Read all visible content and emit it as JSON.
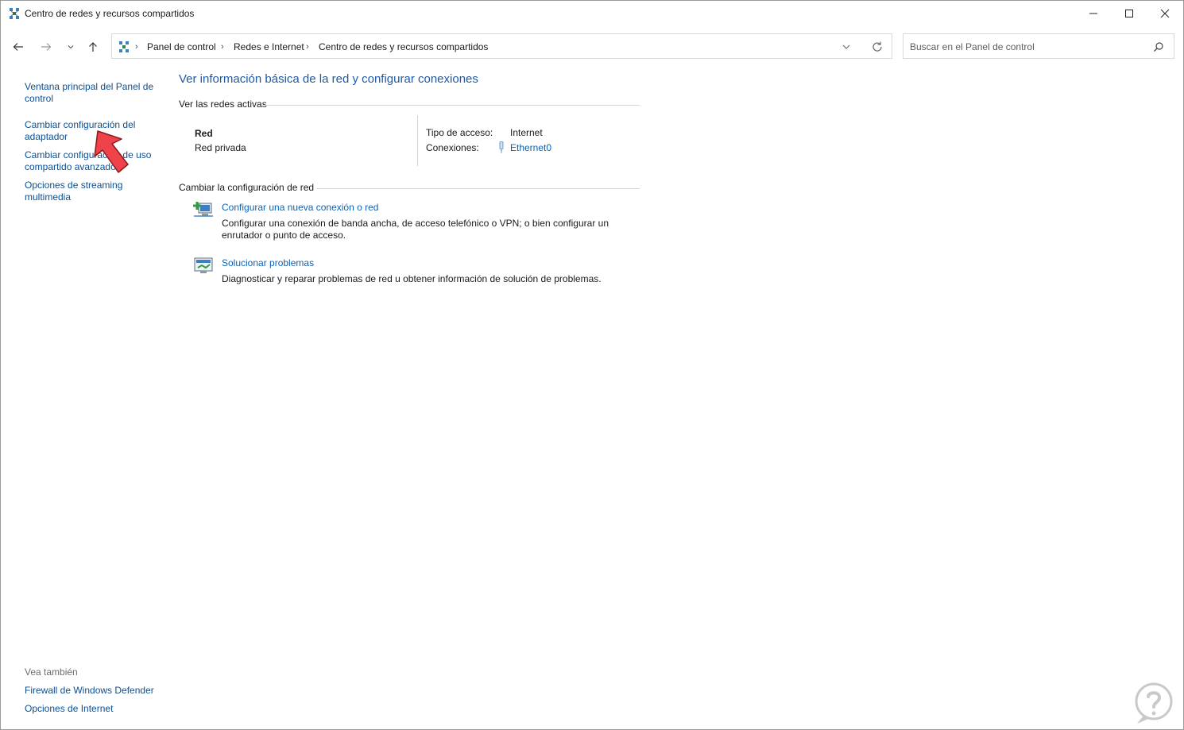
{
  "window": {
    "title": "Centro de redes y recursos compartidos",
    "controls": [
      "minimize-icon",
      "maximize-icon",
      "close-icon"
    ]
  },
  "nav": {
    "back_icon": "arrow-left-icon",
    "forward_icon": "arrow-right-icon",
    "recent_icon": "chevron-down-icon",
    "up_icon": "arrow-up-icon"
  },
  "address": {
    "crumbs": [
      "Panel de control",
      "Redes e Internet",
      "Centro de redes y recursos compartidos"
    ],
    "separator": "›"
  },
  "search": {
    "placeholder": "Buscar en el Panel de control",
    "value": ""
  },
  "sidebar": {
    "items": [
      {
        "label": "Ventana principal del Panel de control"
      },
      {
        "label": "Cambiar configuración del adaptador"
      },
      {
        "label": "Cambiar configuración de uso compartido avanzado"
      },
      {
        "label": "Opciones de streaming multimedia"
      }
    ],
    "see_also_label": "Vea también",
    "see_also": [
      {
        "label": "Firewall de Windows Defender"
      },
      {
        "label": "Opciones de Internet"
      }
    ]
  },
  "main": {
    "heading": "Ver información básica de la red y configurar conexiones",
    "active_networks": {
      "label": "Ver las redes activas",
      "network_name": "Red",
      "network_type": "Red privada",
      "access_type_label": "Tipo de acceso:",
      "access_type_value": "Internet",
      "connections_label": "Conexiones:",
      "connection_name": "Ethernet0"
    },
    "change_settings": {
      "label": "Cambiar la configuración de red",
      "tasks": [
        {
          "title": "Configurar una nueva conexión o red",
          "description": "Configurar una conexión de banda ancha, de acceso telefónico o VPN; o bien configurar un enrutador o punto de acceso."
        },
        {
          "title": "Solucionar problemas",
          "description": "Diagnosticar y reparar problemas de red u obtener información de solución de problemas."
        }
      ]
    }
  },
  "colors": {
    "link": "#0b62b8",
    "heading": "#1c5aa8",
    "annotation_arrow": "#f0424b"
  }
}
